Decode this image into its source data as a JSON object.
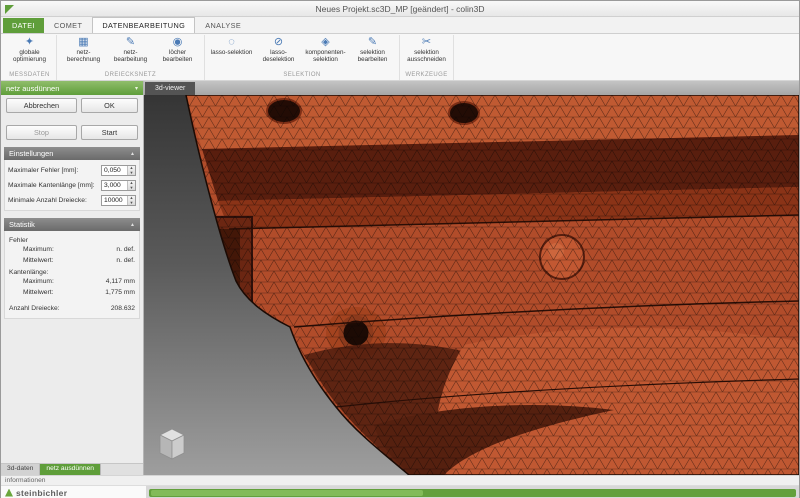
{
  "window": {
    "title": "Neues Projekt.sc3D_MP [geändert] - colin3D"
  },
  "colors": {
    "accent_green": "#5f9e3a",
    "mesh_red": "#b14c2a",
    "icon_blue": "#4a7ab5"
  },
  "icons": {
    "spin_up": "▲",
    "spin_down": "▼",
    "section_collapse": "▲",
    "header_menu": "▾"
  },
  "ribbon": {
    "tabs": [
      {
        "label": "DATEI"
      },
      {
        "label": "COMET"
      },
      {
        "label": "DATENBEARBEITUNG"
      },
      {
        "label": "ANALYSE"
      }
    ],
    "groups": [
      {
        "label": "MESSDATEN",
        "buttons": [
          {
            "label": "globale optimierung",
            "icon": "✦"
          }
        ]
      },
      {
        "label": "DREIECKSNETZ",
        "buttons": [
          {
            "label": "netz-berechnung",
            "icon": "▦"
          },
          {
            "label": "netz-bearbeitung",
            "icon": "✎"
          },
          {
            "label": "löcher bearbeiten",
            "icon": "◉"
          }
        ]
      },
      {
        "label": "SELEKTION",
        "buttons": [
          {
            "label": "lasso-selektion",
            "icon": "◌"
          },
          {
            "label": "lasso-deselektion",
            "icon": "⊘"
          },
          {
            "label": "komponenten-selektion",
            "icon": "◈"
          },
          {
            "label": "selektion bearbeiten",
            "icon": "✎"
          }
        ]
      },
      {
        "label": "WERKZEUGE",
        "buttons": [
          {
            "label": "selektion ausschneiden",
            "icon": "✂"
          }
        ]
      }
    ]
  },
  "panel": {
    "header": "netz ausdünnen",
    "cancel": "Abbrechen",
    "ok": "OK",
    "stop": "Stop",
    "start": "Start",
    "settings": {
      "title": "Einstellungen",
      "fields": [
        {
          "label": "Maximaler Fehler [mm]:",
          "value": "0,050"
        },
        {
          "label": "Maximale Kantenlänge [mm]:",
          "value": "3,000"
        },
        {
          "label": "Minimale Anzahl Dreiecke:",
          "value": "10000"
        }
      ]
    },
    "statistics": {
      "title": "Statistik",
      "groups": [
        {
          "label": "Fehler",
          "rows": [
            {
              "label": "Maximum:",
              "value": "n. def."
            },
            {
              "label": "Mittelwert:",
              "value": "n. def."
            }
          ]
        },
        {
          "label": "Kantenlänge:",
          "rows": [
            {
              "label": "Maximum:",
              "value": "4,117 mm"
            },
            {
              "label": "Mittelwert:",
              "value": "1,775 mm"
            }
          ]
        }
      ],
      "total": {
        "label": "Anzahl Dreiecke:",
        "value": "208.632"
      }
    },
    "tabs": [
      {
        "label": "3d-daten"
      },
      {
        "label": "netz ausdünnen"
      }
    ]
  },
  "viewer": {
    "tab": "3d-viewer"
  },
  "statusbar": {
    "info": "informationen",
    "brand": "steinbichler"
  }
}
